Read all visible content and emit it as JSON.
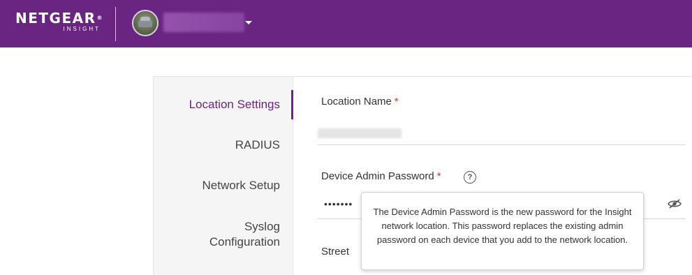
{
  "header": {
    "brand": "NETGEAR",
    "brand_mark": "®",
    "brand_sub": "INSIGHT",
    "background_color": "#6a2481",
    "avatar_icon": "avatar-icon",
    "org_dropdown_icon": "caret-down-icon"
  },
  "sidebar": {
    "items": [
      {
        "label": "Location Settings",
        "active": true
      },
      {
        "label": "RADIUS",
        "active": false
      },
      {
        "label": "Network Setup",
        "active": false
      },
      {
        "label_line1": "Syslog",
        "label_line2": "Configuration",
        "active": false
      }
    ]
  },
  "form": {
    "location_name": {
      "label": "Location Name",
      "required_mark": "*"
    },
    "device_admin_password": {
      "label": "Device Admin Password",
      "required_mark": "*",
      "help_icon_text": "?",
      "masked_value": "•••••••",
      "visibility_icon": "eye-slash-icon"
    },
    "street": {
      "label": "Street"
    }
  },
  "tooltip": {
    "text_before": "The ",
    "bold_term": "Device Admin Password",
    "text_after": " is the new password for the Insight network location. This password replaces the existing admin password on each device that you add to the network location."
  }
}
